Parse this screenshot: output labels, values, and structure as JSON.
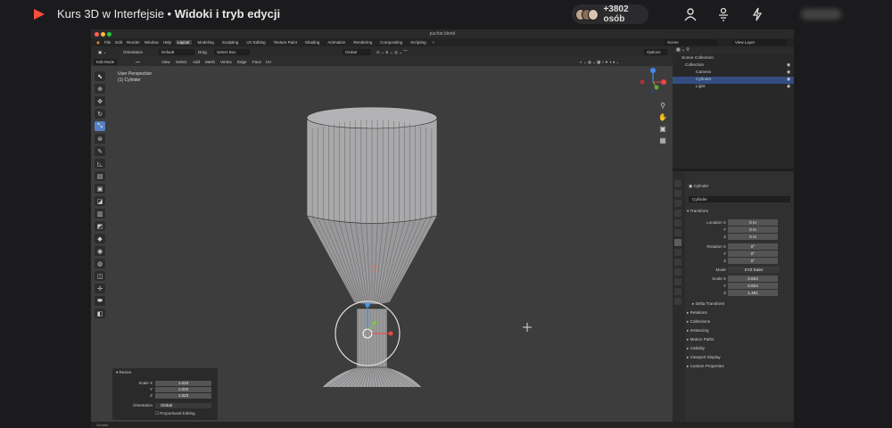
{
  "course": {
    "title_prefix": "Kurs 3D w Interfejsie",
    "separator": " • ",
    "title_bold": "Widoki i tryb edycji",
    "viewers": "+3802 osób"
  },
  "blender": {
    "file": "puchar.blend",
    "menu": [
      "File",
      "Edit",
      "Render",
      "Window",
      "Help"
    ],
    "workspaces": [
      "Layout",
      "Modeling",
      "Sculpting",
      "UV Editing",
      "Texture Paint",
      "Shading",
      "Animation",
      "Rendering",
      "Compositing",
      "Scripting"
    ],
    "scene": "Scene",
    "view_layer": "View Layer",
    "tool_header": {
      "orientation_label": "Orientation",
      "orientation_value": "Default",
      "drag_label": "Drag",
      "drag_value": "Select Box",
      "transform_value": "Global",
      "options": "Options"
    },
    "mode": "Edit Mode",
    "view_menu": [
      "View",
      "Select",
      "Add",
      "Mesh",
      "Vertex",
      "Edge",
      "Face",
      "UV"
    ],
    "viewport": {
      "perspective": "User Perspective",
      "object": "(1) Cylinder"
    },
    "resize_panel": {
      "title": "Resize",
      "scale_label": "Scale X",
      "y_label": "Y",
      "z_label": "Z",
      "x_val": "1.023",
      "y_val": "1.023",
      "z_val": "1.023",
      "orientation_label": "Orientation",
      "orientation_val": "Global",
      "proportional": "Proportional Editing"
    },
    "status": "Scroller",
    "outliner": {
      "scene_collection": "Scene Collection",
      "items": [
        "Collection",
        "Camera",
        "Cylinder",
        "Light"
      ]
    },
    "properties": {
      "object_name": "Cylinder",
      "data_name": "Cylinder",
      "transform": "Transform",
      "location_label": "Location X",
      "loc": [
        "0 m",
        "0 m",
        "0 m"
      ],
      "rotation_label": "Rotation X",
      "rot": [
        "0°",
        "0°",
        "0°"
      ],
      "mode_label": "Mode",
      "mode_val": "XYZ Euler",
      "scale_label": "Scale X",
      "scale": [
        "0.824",
        "0.824",
        "1.451"
      ],
      "y": "Y",
      "z": "Z",
      "delta": "Delta Transform",
      "sections": [
        "Relations",
        "Collections",
        "Instancing",
        "Motion Paths",
        "Visibility",
        "Viewport Display",
        "Custom Properties"
      ]
    }
  }
}
